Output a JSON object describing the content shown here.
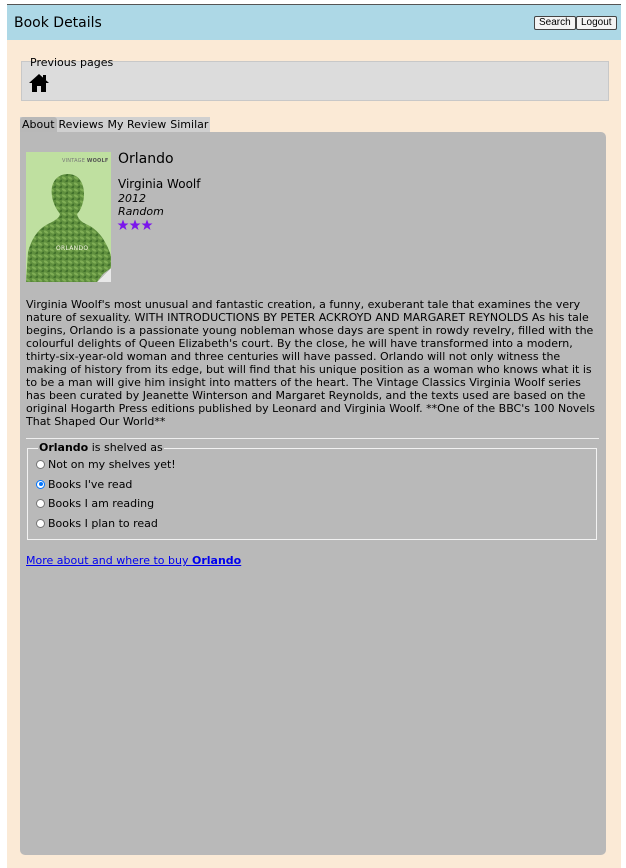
{
  "header": {
    "title": "Book Details",
    "search_label": "Search",
    "logout_label": "Logout"
  },
  "previous_pages": {
    "label": "Previous pages",
    "home_icon": "home-icon"
  },
  "tabs": [
    {
      "label": "About",
      "active": true
    },
    {
      "label": "Reviews",
      "active": false
    },
    {
      "label": "My Review",
      "active": false
    },
    {
      "label": "Similar",
      "active": false
    }
  ],
  "book": {
    "title": "Orlando",
    "author": "Virginia Woolf",
    "year": "2012",
    "publisher": "Random",
    "rating": 3,
    "star_color": "#7b16ec",
    "cover": {
      "publisher_text": "VINTAGE",
      "author_text": "WOOLF",
      "title_text": "ORLANDO"
    },
    "description": "Virginia Woolf's most unusual and fantastic creation, a funny, exuberant tale that examines the very nature of sexuality. WITH INTRODUCTIONS BY PETER ACKROYD AND MARGARET REYNOLDS As his tale begins, Orlando is a passionate young nobleman whose days are spent in rowdy revelry, filled with the colourful delights of Queen Elizabeth's court. By the close, he will have transformed into a modern, thirty-six-year-old woman and three centuries will have passed. Orlando will not only witness the making of history from its edge, but will find that his unique position as a woman who knows what it is to be a man will give him insight into matters of the heart. The Vintage Classics Virginia Woolf series has been curated by Jeanette Winterson and Margaret Reynolds, and the texts used are based on the original Hogarth Press editions published by Leonard and Virginia Woolf. **One of the BBC's 100 Novels That Shaped Our World**"
  },
  "shelf": {
    "legend_title": "Orlando",
    "legend_suffix": " is shelved as",
    "options": [
      {
        "label": "Not on my shelves yet!",
        "checked": false
      },
      {
        "label": "Books I've read",
        "checked": true
      },
      {
        "label": "Books I am reading",
        "checked": false
      },
      {
        "label": "Books I plan to read",
        "checked": false
      }
    ]
  },
  "more_link": {
    "prefix": "More about and where to buy ",
    "title": "Orlando"
  }
}
